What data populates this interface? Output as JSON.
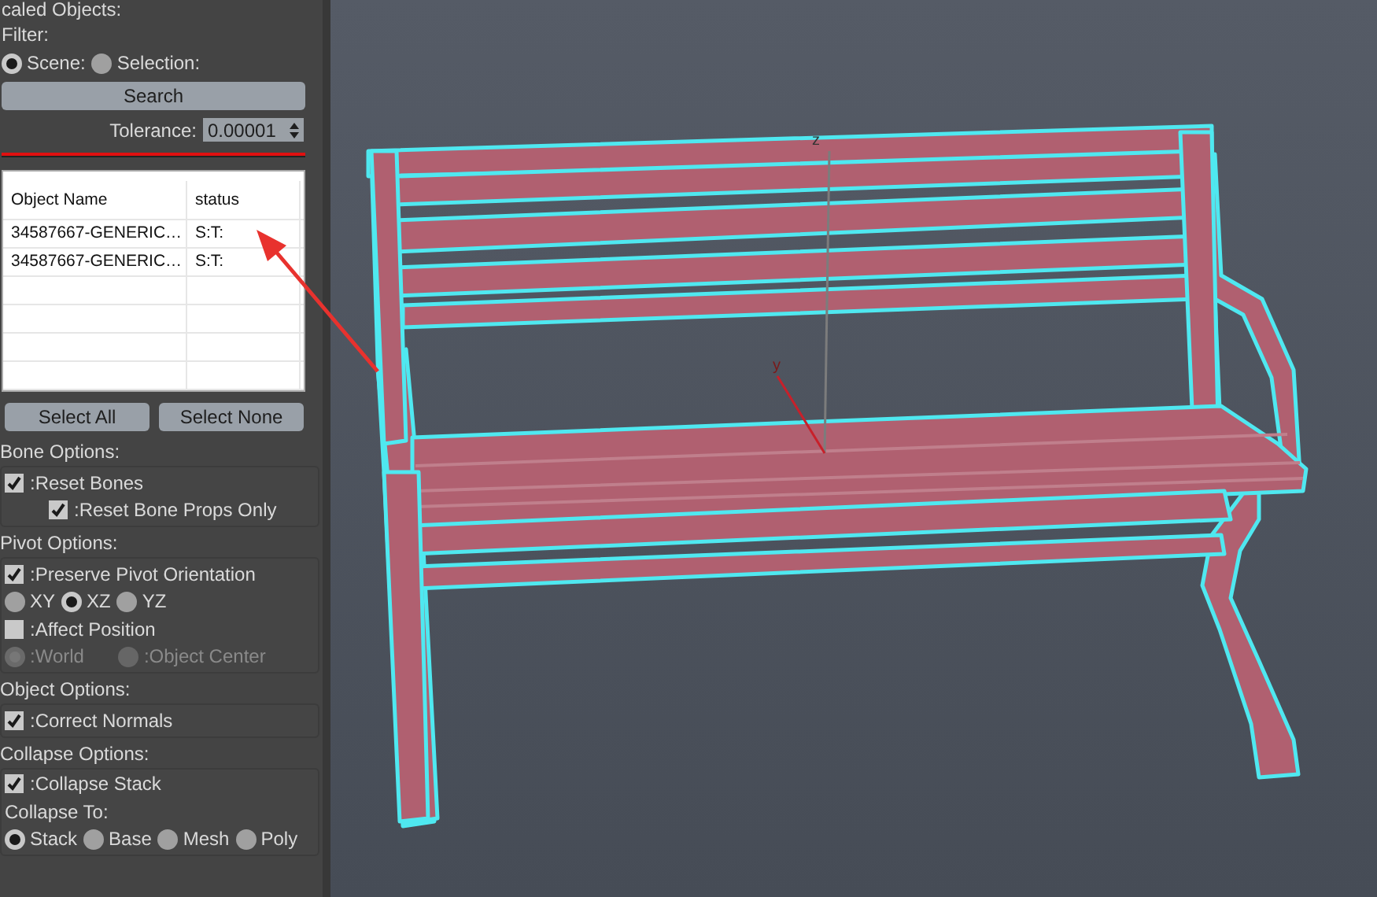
{
  "scaled_objects": {
    "title": "caled Objects:",
    "filter_label": "Filter:",
    "filter_options": [
      {
        "label": "Scene:",
        "selected": true
      },
      {
        "label": "Selection:",
        "selected": false
      }
    ],
    "search_button": "Search",
    "tolerance": {
      "label": "Tolerance:",
      "value": "0.00001"
    },
    "table": {
      "columns": [
        "Object Name",
        "status"
      ],
      "rows": [
        [
          "34587667-GENERIC…",
          "S:T:"
        ],
        [
          "34587667-GENERIC…",
          "S:T:"
        ]
      ]
    },
    "buttons": [
      "Select All",
      "Select None"
    ]
  },
  "option_groups": [
    {
      "title": "Bone Options:",
      "items": [
        {
          "kind": "checkbox",
          "label": ":Reset Bones",
          "checked": true,
          "children": [
            {
              "kind": "checkbox",
              "label": ":Reset Bone Props Only",
              "checked": true
            }
          ]
        }
      ]
    },
    {
      "title": "Pivot Options:",
      "items": [
        {
          "kind": "checkbox",
          "label": ":Preserve Pivot Orientation",
          "checked": true
        },
        {
          "kind": "radios",
          "options": [
            {
              "label": "XY",
              "selected": false,
              "disabled": false
            },
            {
              "label": "XZ",
              "selected": true,
              "disabled": false
            },
            {
              "label": "YZ",
              "selected": false,
              "disabled": false
            }
          ]
        },
        {
          "kind": "checkbox",
          "label": ":Affect Position",
          "checked": false
        },
        {
          "kind": "radios",
          "options": [
            {
              "label": ":World",
              "selected": true,
              "disabled": true
            },
            {
              "label": ":Object Center",
              "selected": false,
              "disabled": true
            }
          ]
        }
      ]
    },
    {
      "title": "Object Options:",
      "items": [
        {
          "kind": "checkbox",
          "label": ":Correct Normals",
          "checked": true
        }
      ]
    },
    {
      "title": "Collapse Options:",
      "items": [
        {
          "kind": "checkbox",
          "label": ":Collapse Stack",
          "checked": true
        },
        {
          "kind": "label",
          "label": "Collapse To:"
        },
        {
          "kind": "radios",
          "options": [
            {
              "label": "Stack",
              "selected": true,
              "disabled": false
            },
            {
              "label": "Base",
              "selected": false,
              "disabled": false
            },
            {
              "label": "Mesh",
              "selected": false,
              "disabled": false
            },
            {
              "label": "Poly",
              "selected": false,
              "disabled": false
            }
          ]
        }
      ]
    }
  ],
  "viewport": {
    "axis_labels": [
      {
        "kind": "z",
        "text": "z"
      },
      {
        "kind": "y",
        "text": "y"
      }
    ]
  }
}
